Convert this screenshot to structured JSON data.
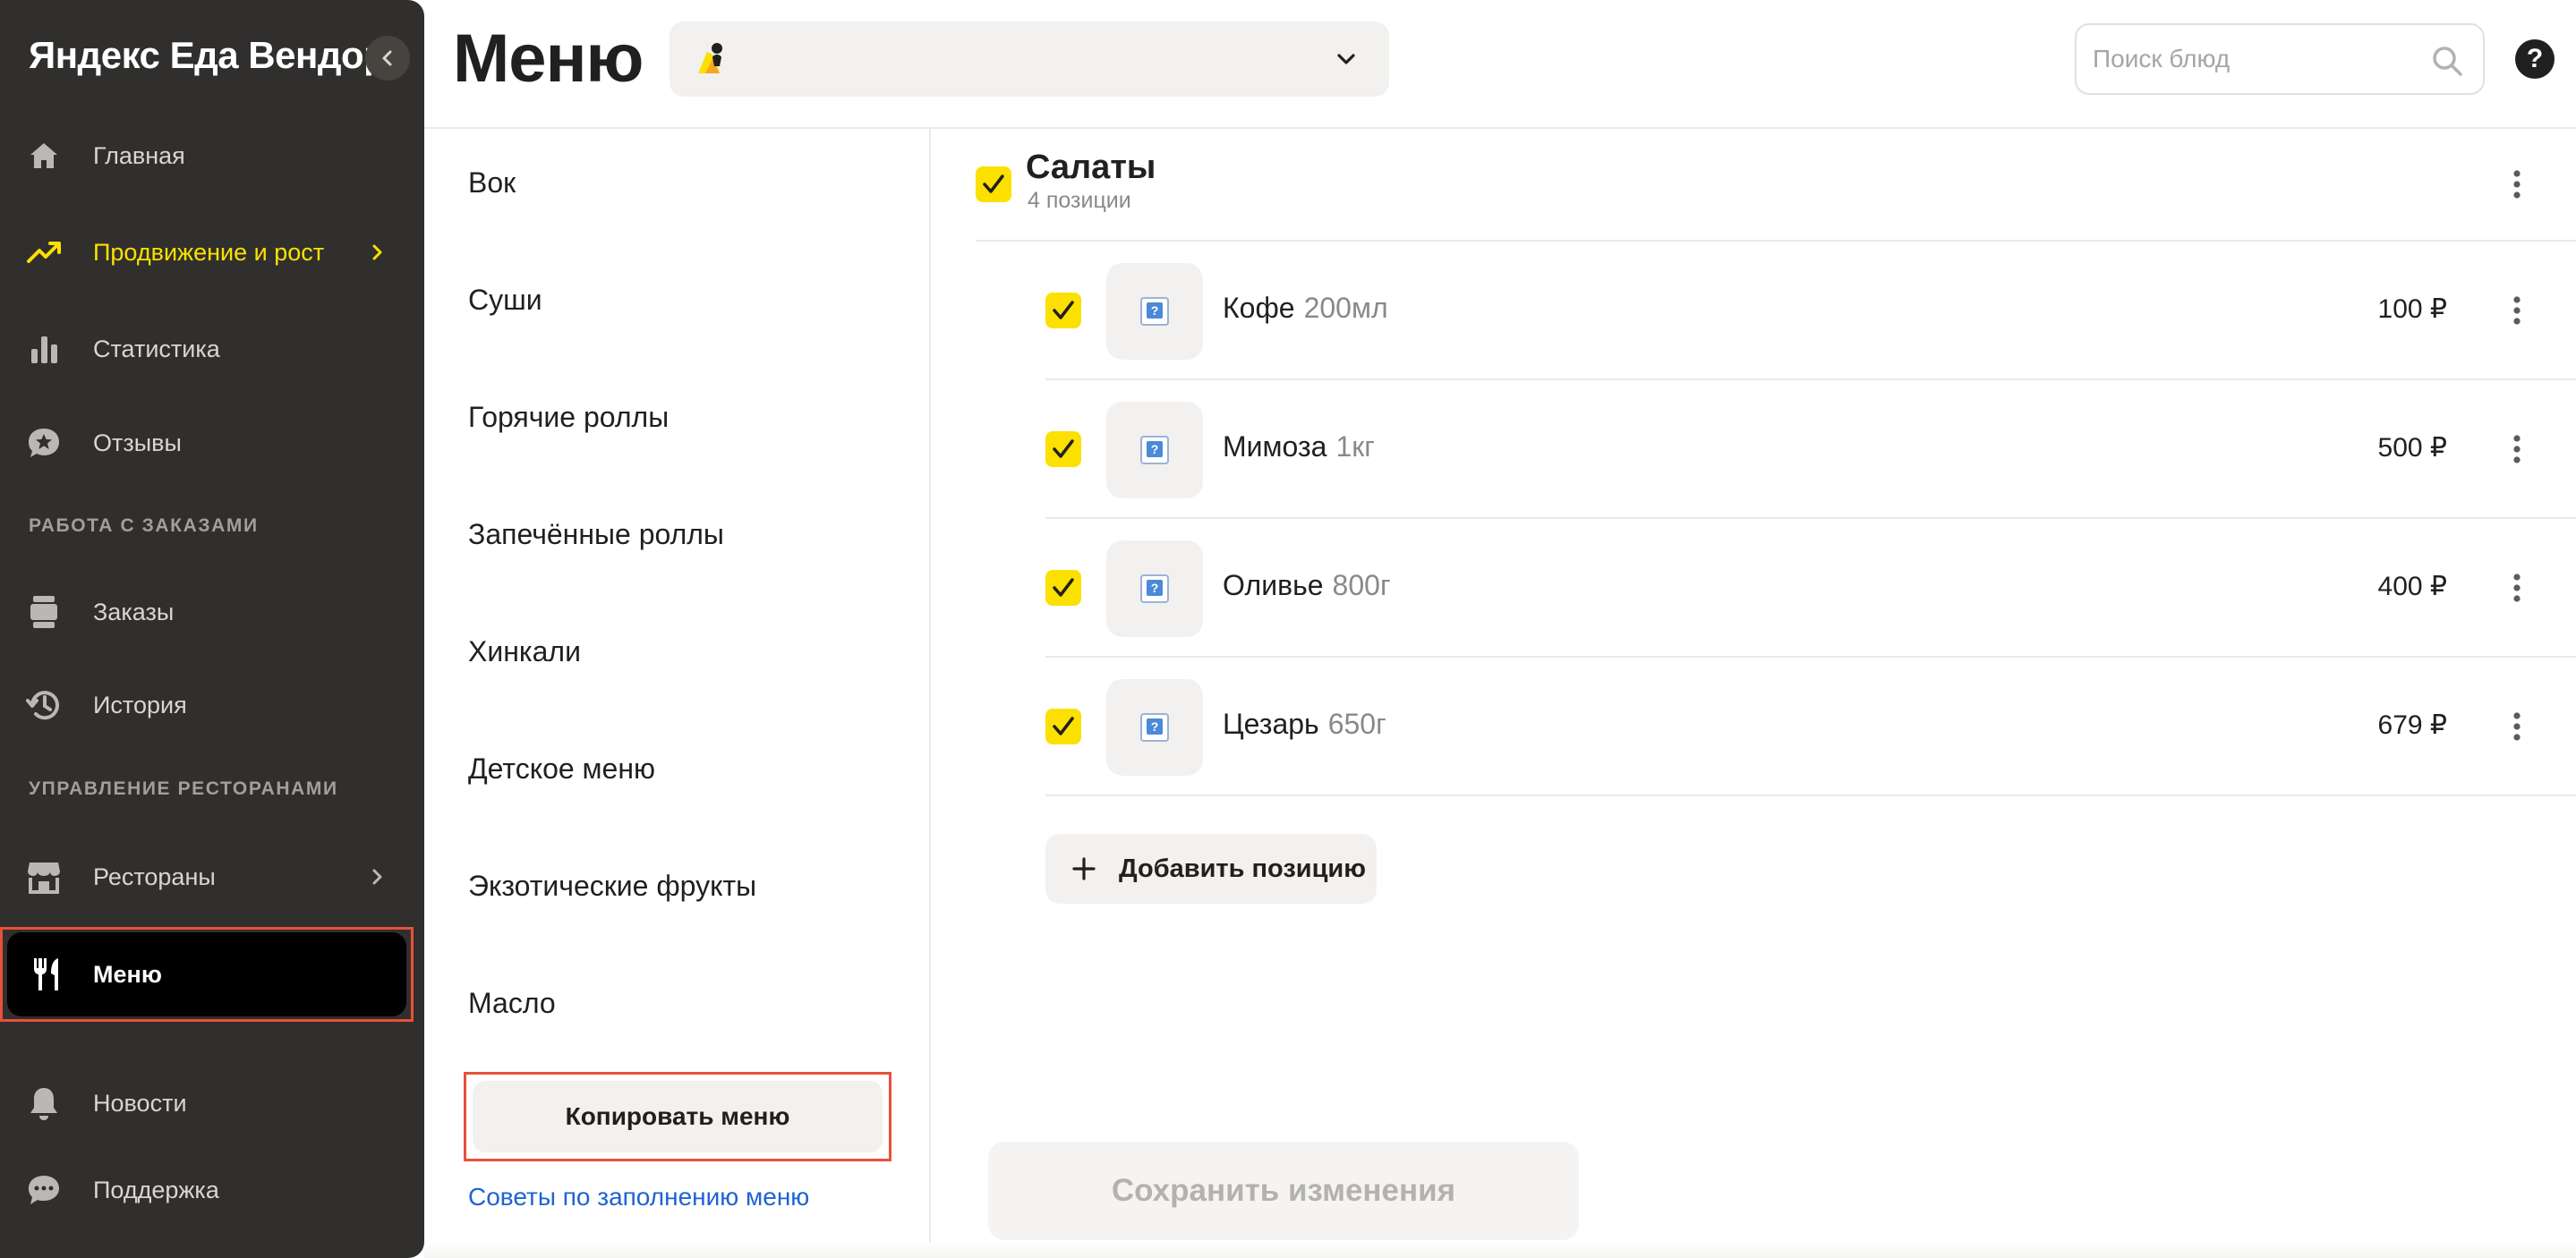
{
  "sidebar": {
    "brand": "Яндекс Еда Вендор",
    "items": [
      {
        "label": "Главная",
        "icon": "home-icon"
      },
      {
        "label": "Продвижение и рост",
        "icon": "trend-up-icon"
      },
      {
        "label": "Статистика",
        "icon": "bar-chart-icon"
      },
      {
        "label": "Отзывы",
        "icon": "review-star-icon"
      },
      {
        "label": "Заказы",
        "icon": "orders-icon"
      },
      {
        "label": "История",
        "icon": "history-icon"
      },
      {
        "label": "Рестораны",
        "icon": "store-icon"
      },
      {
        "label": "Меню",
        "icon": "fork-knife-icon"
      },
      {
        "label": "Новости",
        "icon": "bell-icon"
      },
      {
        "label": "Поддержка",
        "icon": "chat-icon"
      }
    ],
    "sections": [
      "РАБОТА С ЗАКАЗАМИ",
      "УПРАВЛЕНИЕ РЕСТОРАНАМИ"
    ],
    "active_item": "Меню",
    "highlight_color": "#fce000"
  },
  "header": {
    "title": "Меню",
    "restaurant_selected": "",
    "search_placeholder": "Поиск блюд",
    "help": "?"
  },
  "categories": {
    "items": [
      "Вок",
      "Суши",
      "Горячие роллы",
      "Запечённые роллы",
      "Хинкали",
      "Детское меню",
      "Экзотические фрукты",
      "Масло"
    ],
    "copy_button": "Копировать меню",
    "tips_link": "Советы по заполнению меню"
  },
  "group": {
    "title": "Салаты",
    "count": "4 позиции",
    "items": [
      {
        "name": "Кофе",
        "weight": "200мл",
        "price": "100 ₽"
      },
      {
        "name": "Мимоза",
        "weight": "1кг",
        "price": "500 ₽"
      },
      {
        "name": "Оливье",
        "weight": "800г",
        "price": "400 ₽"
      },
      {
        "name": "Цезарь",
        "weight": "650г",
        "price": "679 ₽"
      }
    ],
    "add_button": "Добавить позицию"
  },
  "footer": {
    "save_button": "Сохранить изменения"
  },
  "colors": {
    "accent_yellow": "#fce000",
    "sidebar_bg": "#302f2d",
    "link_blue": "#1f62d4",
    "highlight_frame": "#e8503a"
  }
}
